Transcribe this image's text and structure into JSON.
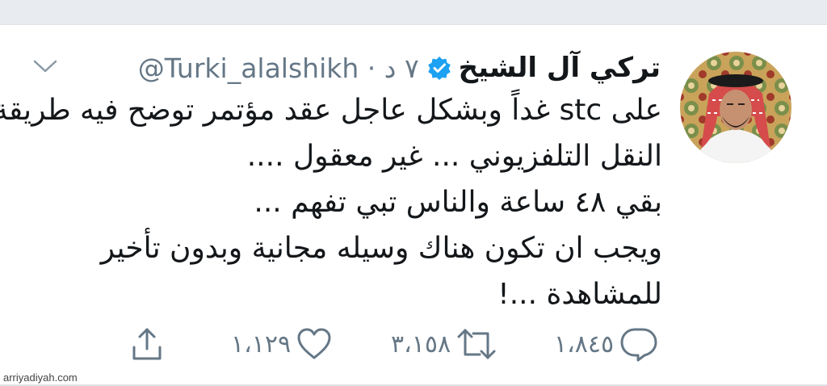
{
  "tweet": {
    "display_name": "تركي آل الشيخ",
    "handle_time": "@Turki_alalshikh · ٧ د",
    "lines": [
      "على stc غداً وبشكل عاجل عقد مؤتمر توضح فيه طريقة",
      "النقل التلفزيوني ... غير معقول ....",
      "بقي ٤٨ ساعة والناس تبي تفهم ...",
      "ويجب ان تكون هناك وسيله مجانية وبدون تأخير",
      "للمشاهدة ...!"
    ]
  },
  "actions": {
    "reply_count": "١،٨٤٥",
    "retweet_count": "٣،١٥٨",
    "like_count": "١،١٢٩"
  },
  "watermark": "arriyadiyah.com",
  "colors": {
    "text": "#14171a",
    "secondary": "#657786",
    "verified": "#1da1f2",
    "top_bar": "#e8ebef"
  },
  "icons": {
    "verified": "verified-badge-icon",
    "caret": "chevron-down-icon",
    "reply": "reply-icon",
    "retweet": "retweet-icon",
    "like": "heart-icon",
    "share": "share-icon"
  }
}
